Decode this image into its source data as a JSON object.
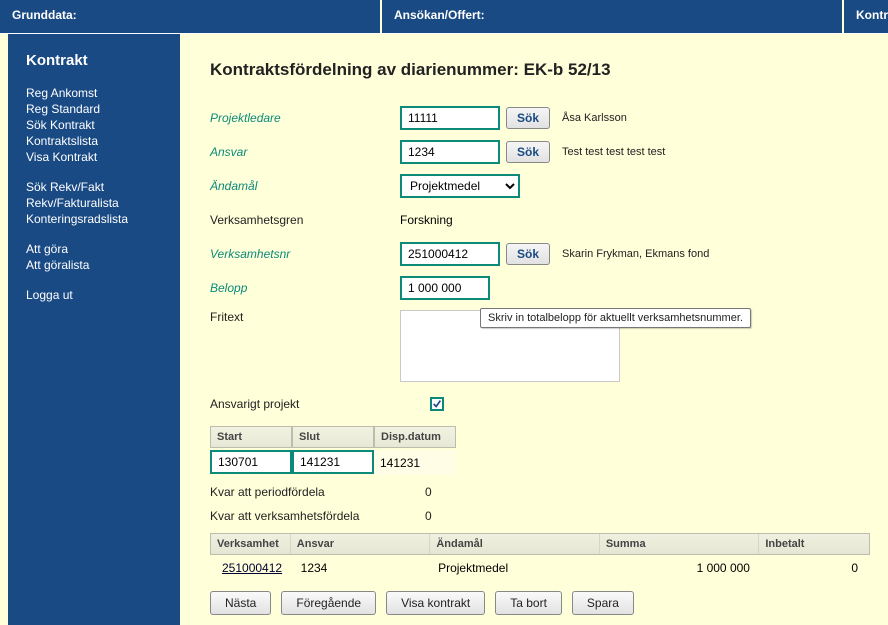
{
  "topnav": {
    "grunddata": "Grunddata:",
    "ansokan": "Ansökan/Offert:",
    "kontr": "Kontr"
  },
  "sidebar": {
    "heading": "Kontrakt",
    "group1": [
      "Reg Ankomst",
      "Reg Standard",
      "Sök Kontrakt",
      "Kontraktslista",
      "Visa Kontrakt"
    ],
    "group2": [
      "Sök Rekv/Fakt",
      "Rekv/Fakturalista",
      "Konteringsradslista"
    ],
    "group3": [
      "Att göra",
      "Att göralista"
    ],
    "group4": [
      "Logga ut"
    ]
  },
  "page": {
    "title_prefix": "Kontraktsfördelning av diarienummer: ",
    "diarienummer": "EK-b 52/13"
  },
  "labels": {
    "projektledare": "Projektledare",
    "ansvar": "Ansvar",
    "andamal": "Ändamål",
    "verksamhetsgren": "Verksamhetsgren",
    "verksamhetsnr": "Verksamhetsnr",
    "belopp": "Belopp",
    "fritext": "Fritext",
    "ansvarigt_projekt": "Ansvarigt projekt",
    "kvar_period": "Kvar att periodfördela",
    "kvar_verksamhet": "Kvar att verksamhetsfördela"
  },
  "values": {
    "projektledare": "11111",
    "projektledare_name": "Åsa Karlsson",
    "ansvar": "1234",
    "ansvar_name": "Test test test test test",
    "andamal_selected": "Projektmedel",
    "verksamhetsgren": "Forskning",
    "verksamhetsnr": "251000412",
    "verksamhetsnr_name": "Skarin Frykman, Ekmans fond",
    "belopp": "1 000 000",
    "kvar_period": "0",
    "kvar_verksamhet": "0",
    "ansvarigt_projekt_checked": true
  },
  "tooltip": "Skriv in totalbelopp för aktuellt verksamhetsnummer.",
  "buttons": {
    "sok": "Sök",
    "nasta": "Nästa",
    "foregaende": "Föregående",
    "visa_kontrakt": "Visa kontrakt",
    "ta_bort": "Ta bort",
    "spara": "Spara"
  },
  "date_table": {
    "headers": {
      "start": "Start",
      "slut": "Slut",
      "disp": "Disp.datum"
    },
    "start": "130701",
    "slut": "141231",
    "disp": "141231"
  },
  "grid": {
    "headers": {
      "verksamhet": "Verksamhet",
      "ansvar": "Ansvar",
      "andamal": "Ändamål",
      "summa": "Summa",
      "inbetalt": "Inbetalt"
    },
    "rows": [
      {
        "verksamhet": "251000412",
        "ansvar": "1234",
        "andamal": "Projektmedel",
        "summa": "1 000 000",
        "inbetalt": "0"
      }
    ]
  }
}
